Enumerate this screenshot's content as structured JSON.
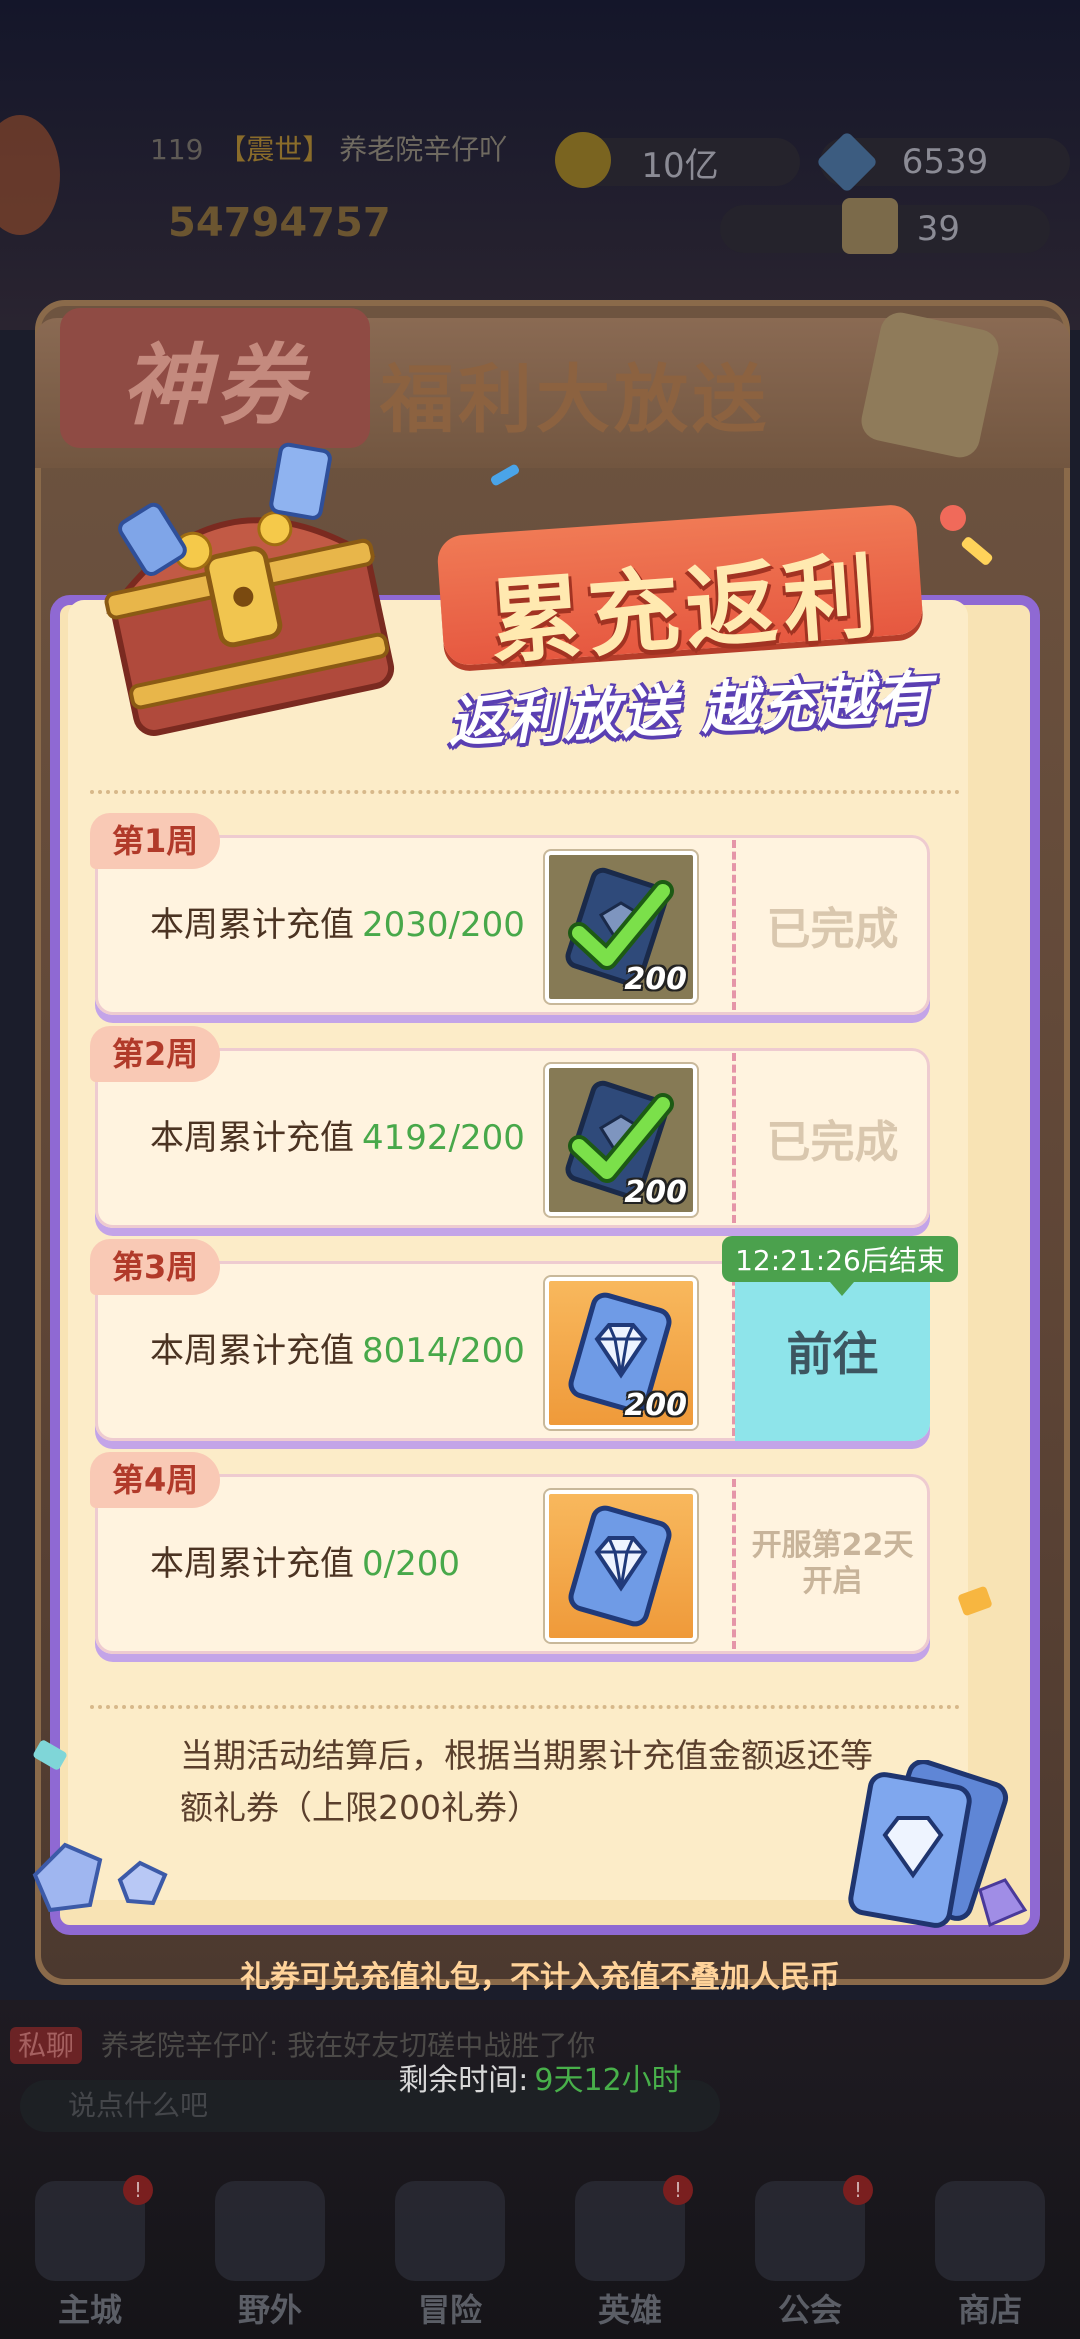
{
  "hud": {
    "level": "119",
    "guild_tag": "【震世】",
    "player_name": "养老院辛仔吖",
    "power": "54794757",
    "gold": "10亿",
    "diamonds": "6539",
    "tickets": "39"
  },
  "modal": {
    "tab_label": "神券",
    "header_title": "福利大放送",
    "banner_title": "累充返利",
    "banner_subtitle": "返利放送 越充越有"
  },
  "rows": [
    {
      "week": "第1周",
      "label": "本周累计充值",
      "progress": "2030/200",
      "reward_count": "200",
      "status": "已完成"
    },
    {
      "week": "第2周",
      "label": "本周累计充值",
      "progress": "4192/200",
      "reward_count": "200",
      "status": "已完成"
    },
    {
      "week": "第3周",
      "label": "本周累计充值",
      "progress": "8014/200",
      "reward_count": "200",
      "action": "前往",
      "timer": "12:21:26后结束"
    },
    {
      "week": "第4周",
      "label": "本周累计充值",
      "progress": "0/200",
      "status_line1": "开服第22天",
      "status_line2": "开启"
    }
  ],
  "note": "当期活动结算后，根据当期累计充值金额返还等额礼券（上限200礼券）",
  "footer_note": "礼券可兑充值礼包，不计入充值不叠加人民币",
  "remaining_label": "剩余时间:",
  "remaining_value": "9天12小时",
  "chat": {
    "channel": "私聊",
    "message": "养老院辛仔吖: 我在好友切磋中战胜了你",
    "input_placeholder": "说点什么吧"
  },
  "nav": [
    {
      "label": "主城",
      "icon": "castle-icon",
      "badge": "!"
    },
    {
      "label": "野外",
      "icon": "field-icon"
    },
    {
      "label": "冒险",
      "icon": "adventure-icon"
    },
    {
      "label": "英雄",
      "icon": "hero-helmet-icon",
      "badge": "!"
    },
    {
      "label": "公会",
      "icon": "guild-banner-icon",
      "badge": "!"
    },
    {
      "label": "商店",
      "icon": "shop-icon"
    }
  ],
  "colors": {
    "accent_green": "#48a84a",
    "purple_frame": "#8f69d3",
    "banner_red": "#e65840",
    "goto_cyan": "#8ee4ea"
  }
}
